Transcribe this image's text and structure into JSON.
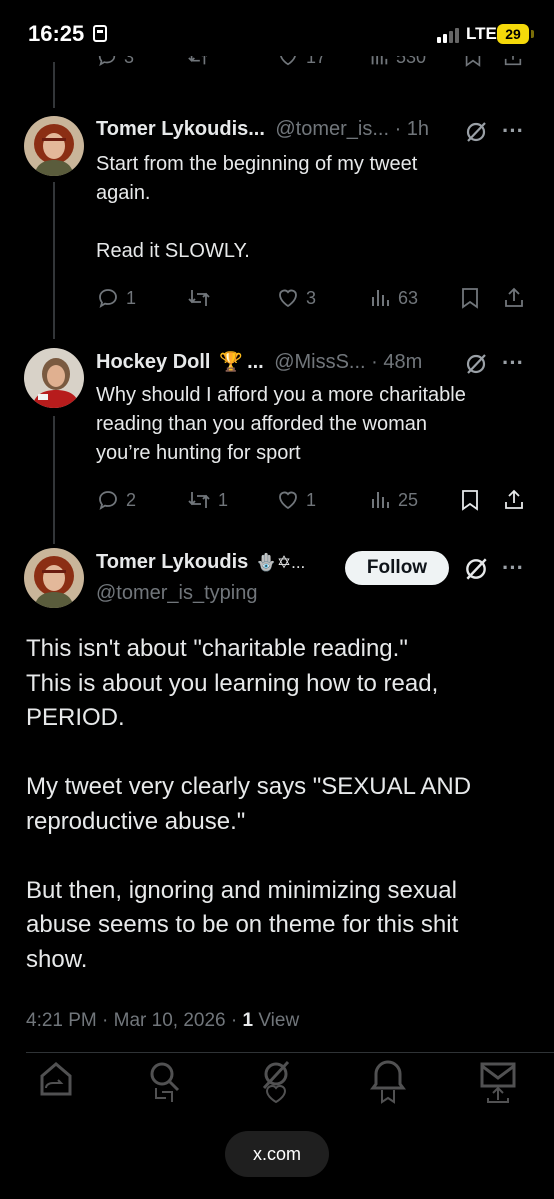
{
  "status_bar": {
    "time": "16:25",
    "network": "LTE",
    "battery": "29"
  },
  "top_actions": {
    "replies": "3",
    "likes": "17",
    "views": "530"
  },
  "reply1": {
    "name": "Tomer Lykoudis...",
    "handle_time": "@tomer_is... · 1h",
    "text": "Start from the beginning of my tweet\nagain.\n\nRead it SLOWLY.",
    "replies": "1",
    "likes": "3",
    "views": "63"
  },
  "reply2": {
    "name": "Hockey Doll",
    "badge": "🏆",
    "ellipsis": "...",
    "handle_time": "@MissS... · 48m",
    "text": "Why should I afford you a more charitable\nreading than you afforded the woman\nyou’re hunting for sport",
    "replies": "2",
    "reposts": "1",
    "likes": "1",
    "views": "25"
  },
  "main_post": {
    "name": "Tomer Lykoudis",
    "name_emoji": "🪬✡...",
    "handle": "@tomer_is_typing",
    "follow_label": "Follow",
    "text": "This isn't about \"charitable reading.\"\nThis is about you learning how to read,\nPERIOD.\n\nMy tweet very clearly says \"SEXUAL AND\nreproductive abuse.\"\n\nBut then, ignoring and minimizing sexual\nabuse seems to be on theme for this shit\nshow.",
    "time_date": "4:21 PM · Mar 10, 2026 · ",
    "view_count": "1",
    "view_label": " View"
  },
  "browser": {
    "url": "x.com"
  },
  "colors": {
    "background": "#000000",
    "text": "#e7e9ea",
    "muted": "#71767b",
    "battery": "#f5d90a"
  }
}
